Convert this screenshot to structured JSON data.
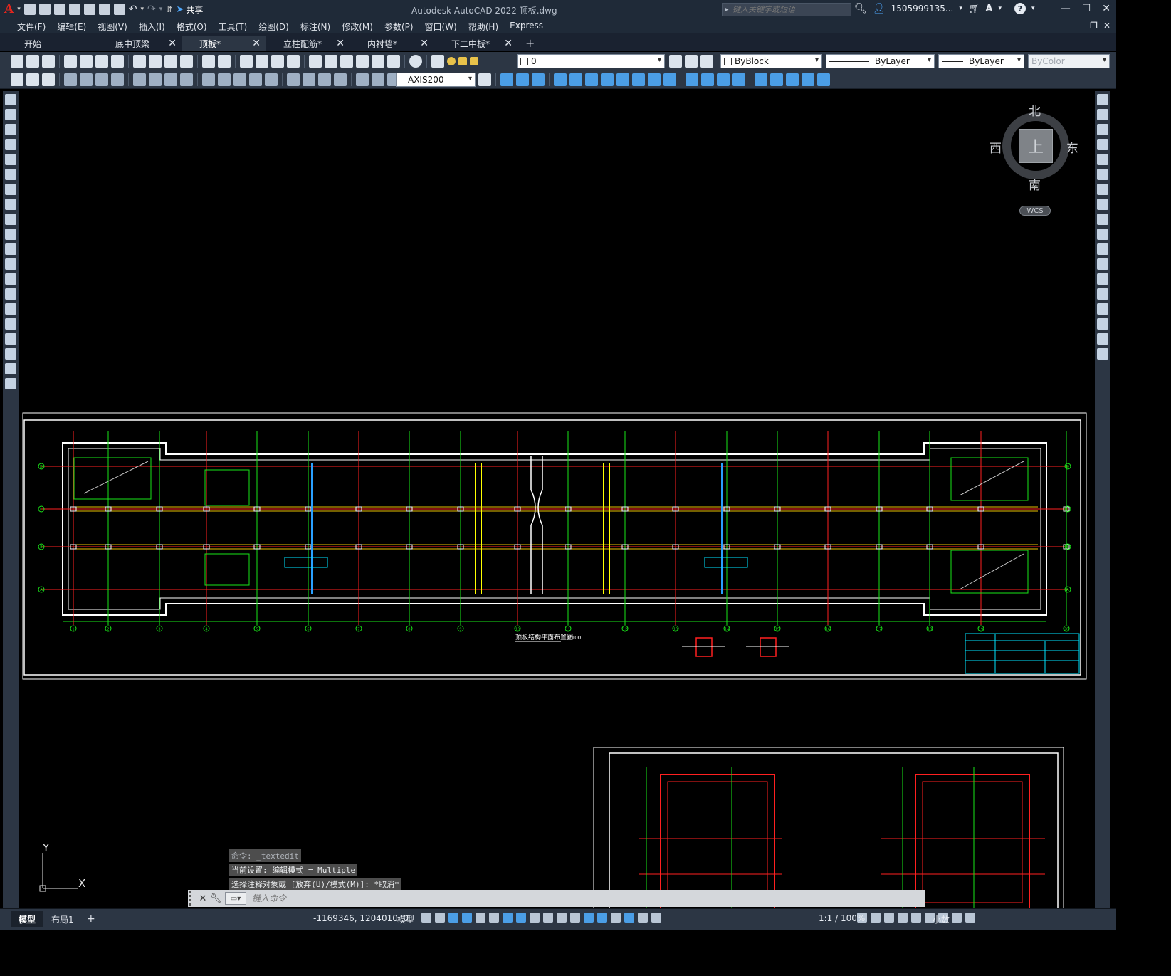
{
  "titlebar": {
    "share_label": "共享",
    "app_title": "Autodesk AutoCAD 2022    顶板.dwg",
    "search_placeholder": "键入关键字或短语",
    "user_name": "1505999135...",
    "help_label": "?"
  },
  "menu": [
    "文件(F)",
    "编辑(E)",
    "视图(V)",
    "插入(I)",
    "格式(O)",
    "工具(T)",
    "绘图(D)",
    "标注(N)",
    "修改(M)",
    "参数(P)",
    "窗口(W)",
    "帮助(H)",
    "Express"
  ],
  "tabs": [
    {
      "label": "开始",
      "active": false,
      "closable": false
    },
    {
      "label": "底中顶梁",
      "active": false,
      "closable": true
    },
    {
      "label": "顶板*",
      "active": true,
      "closable": true
    },
    {
      "label": "立柱配筋*",
      "active": false,
      "closable": true
    },
    {
      "label": "内衬墙*",
      "active": false,
      "closable": true
    },
    {
      "label": "下二中板*",
      "active": false,
      "closable": true
    }
  ],
  "properties": {
    "layer": "0",
    "color": "ByBlock",
    "linetype": "ByLayer",
    "lineweight": "ByLayer",
    "plotstyle": "ByColor",
    "dimstyle": "AXIS200"
  },
  "viewcube": {
    "north": "北",
    "south": "南",
    "east": "东",
    "west": "西",
    "face": "上",
    "wcs": "WCS"
  },
  "ucs": {
    "y": "Y",
    "x": "X"
  },
  "command": {
    "history": [
      "命令: _textedit",
      "当前设置: 编辑模式 = Multiple",
      "选择注释对象或 [放弃(U)/模式(M)]: *取消*"
    ],
    "placeholder": "键入命令"
  },
  "status": {
    "layouts": [
      {
        "label": "模型",
        "active": true
      },
      {
        "label": "布局1",
        "active": false
      }
    ],
    "coords": "-1169346, 1204010, 0",
    "mode": "模型",
    "scale": "1:1 / 100%",
    "units": "小数"
  },
  "drawing": {
    "title": "顶板结构平面布置图",
    "scale": "1:100",
    "grid_labels": [
      "D",
      "C",
      "B",
      "A"
    ],
    "axis_numbers": [
      "1",
      "2",
      "3",
      "4",
      "5",
      "6",
      "7",
      "8",
      "9",
      "10",
      "11",
      "12",
      "13",
      "14",
      "15",
      "16",
      "17",
      "18",
      "19",
      "20",
      "21"
    ]
  },
  "colors": {
    "accent": "#4b9ee6",
    "red_line": "#ff2020",
    "green_line": "#19e619",
    "yellow_line": "#ffff00",
    "cyan": "#00e5ff",
    "background": "#000000"
  }
}
